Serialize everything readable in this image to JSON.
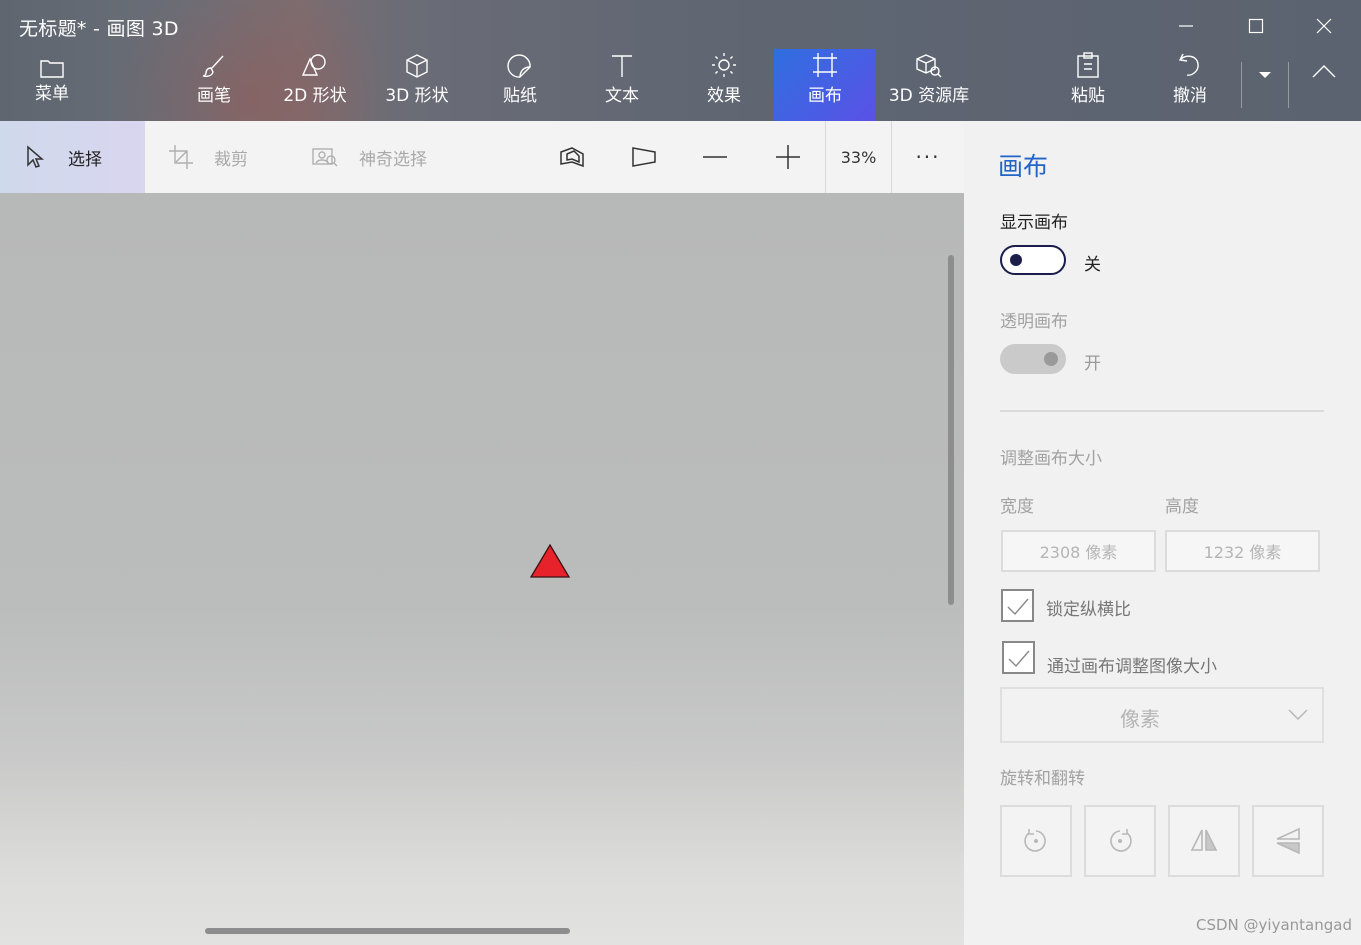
{
  "window": {
    "title": "无标题* - 画图 3D"
  },
  "toolbar": {
    "menu": "菜单",
    "brushes": "画笔",
    "shapes2d": "2D 形状",
    "shapes3d": "3D 形状",
    "stickers": "贴纸",
    "text": "文本",
    "effects": "效果",
    "canvas": "画布",
    "library3d": "3D 资源库",
    "paste": "粘贴",
    "undo": "撤消",
    "active_tab": "画布"
  },
  "subtoolbar": {
    "select": "选择",
    "crop": "裁剪",
    "magic_select": "神奇选择",
    "zoom": "33%",
    "more": "···"
  },
  "panel": {
    "title": "画布",
    "show_canvas_label": "显示画布",
    "show_canvas_state": "关",
    "transparent_canvas_label": "透明画布",
    "transparent_canvas_state": "开",
    "resize_heading": "调整画布大小",
    "width_label": "宽度",
    "height_label": "高度",
    "width_value": "2308 像素",
    "height_value": "1232 像素",
    "lock_ratio_label": "锁定纵横比",
    "resize_image_label": "通过画布调整图像大小",
    "unit_value": "像素",
    "rotate_heading": "旋转和翻转"
  },
  "watermark": "CSDN @yiyantangad",
  "colors": {
    "accent": "#2264c8",
    "active_tab_start": "#2f6fe0",
    "active_tab_end": "#5b51e6",
    "triangle_fill": "#e8222b"
  }
}
